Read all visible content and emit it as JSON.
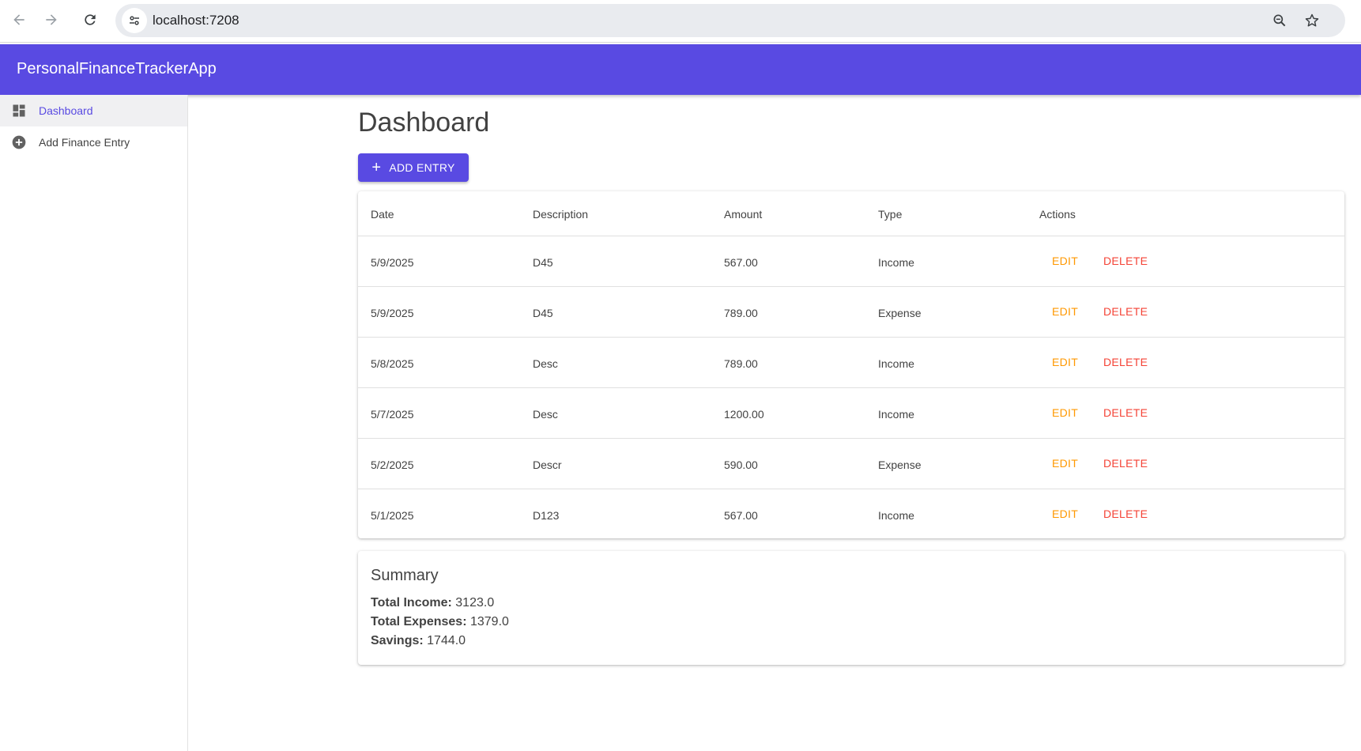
{
  "browser": {
    "url": "localhost:7208"
  },
  "app": {
    "title": "PersonalFinanceTrackerApp"
  },
  "sidebar": {
    "items": [
      {
        "label": "Dashboard",
        "icon": "dashboard-icon",
        "active": true
      },
      {
        "label": "Add Finance Entry",
        "icon": "add-circle-icon",
        "active": false
      }
    ]
  },
  "main": {
    "title": "Dashboard",
    "add_button_label": "ADD ENTRY",
    "table": {
      "headers": [
        "Date",
        "Description",
        "Amount",
        "Type",
        "Actions"
      ],
      "edit_label": "EDIT",
      "delete_label": "DELETE",
      "rows": [
        {
          "date": "5/9/2025",
          "description": "D45",
          "amount": "567.00",
          "type": "Income"
        },
        {
          "date": "5/9/2025",
          "description": "D45",
          "amount": "789.00",
          "type": "Expense"
        },
        {
          "date": "5/8/2025",
          "description": "Desc",
          "amount": "789.00",
          "type": "Income"
        },
        {
          "date": "5/7/2025",
          "description": "Desc",
          "amount": "1200.00",
          "type": "Income"
        },
        {
          "date": "5/2/2025",
          "description": "Descr",
          "amount": "590.00",
          "type": "Expense"
        },
        {
          "date": "5/1/2025",
          "description": "D123",
          "amount": "567.00",
          "type": "Income"
        }
      ]
    },
    "summary": {
      "title": "Summary",
      "total_income_label": "Total Income:",
      "total_income": "3123.0",
      "total_expenses_label": "Total Expenses:",
      "total_expenses": "1379.0",
      "savings_label": "Savings:",
      "savings": "1744.0"
    }
  },
  "colors": {
    "primary": "#594ae2",
    "edit": "#ff9800",
    "delete": "#f44336"
  }
}
